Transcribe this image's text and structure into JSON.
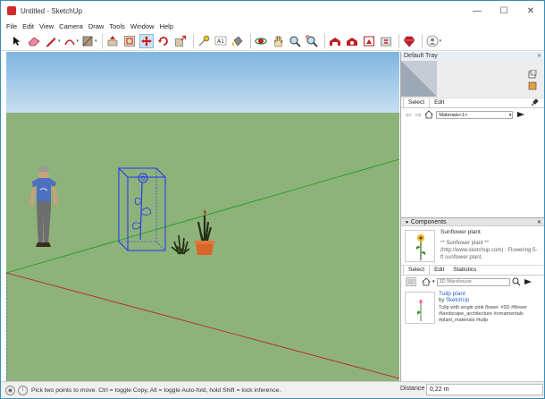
{
  "window": {
    "title": "Untitled - SketchUp",
    "minimize_glyph": "—",
    "maximize_glyph": "☐",
    "close_glyph": "✕"
  },
  "menu": [
    "File",
    "Edit",
    "View",
    "Camera",
    "Draw",
    "Tools",
    "Window",
    "Help"
  ],
  "toolbar": {
    "tools": [
      "select-tool",
      "eraser-tool",
      "line-tool",
      "arc-tool",
      "shape-tool",
      "push-pull-tool",
      "offset-tool",
      "move-tool",
      "rotate-tool",
      "scale-tool",
      "tape-measure-tool",
      "text-tool",
      "paint-bucket-tool",
      "orbit-tool",
      "pan-tool",
      "zoom-tool",
      "zoom-extents-tool",
      "3d-warehouse-tool",
      "extension-warehouse-tool",
      "layout-tool",
      "extension-manager-tool",
      "ruby-tool",
      "profile-tool"
    ],
    "active_tool": "move-tool"
  },
  "tray": {
    "title": "Default Tray",
    "materials": {
      "tabs": [
        "Select",
        "Edit"
      ],
      "selected_tab": "Select",
      "collection": "Materials<1>",
      "swatch_color": "#c5ccd6"
    },
    "components": {
      "header": "Components",
      "selected_name": "Sunflower plant",
      "selected_desc": "** Sunflower plant ** (http://www.sketchup.com) : Flowering 5-ft sunflower plant.",
      "tabs": [
        "Select",
        "Edit",
        "Statistics"
      ],
      "selected_tab": "Select",
      "search_placeholder": "3D Warehouse",
      "result": {
        "title": "Tulip plant",
        "by_prefix": "by ",
        "author": "SketchUp",
        "desc": "Tulip with single pink flower. #3D #flower #landscape_architecture #ornamentals #plant_materials #tulip"
      }
    }
  },
  "status": {
    "hint": "Pick two points to move.  Ctrl = toggle Copy, Alt = toggle Auto-fold, hold Shift = lock inference.",
    "distance_label": "Distance",
    "distance_value": "0,22 m"
  },
  "colors": {
    "sky": "#9ec6e8",
    "ground": "#8db27a",
    "accent": "#2b8fb3",
    "selection_box": "#2233ff",
    "link": "#1f5fbf"
  }
}
